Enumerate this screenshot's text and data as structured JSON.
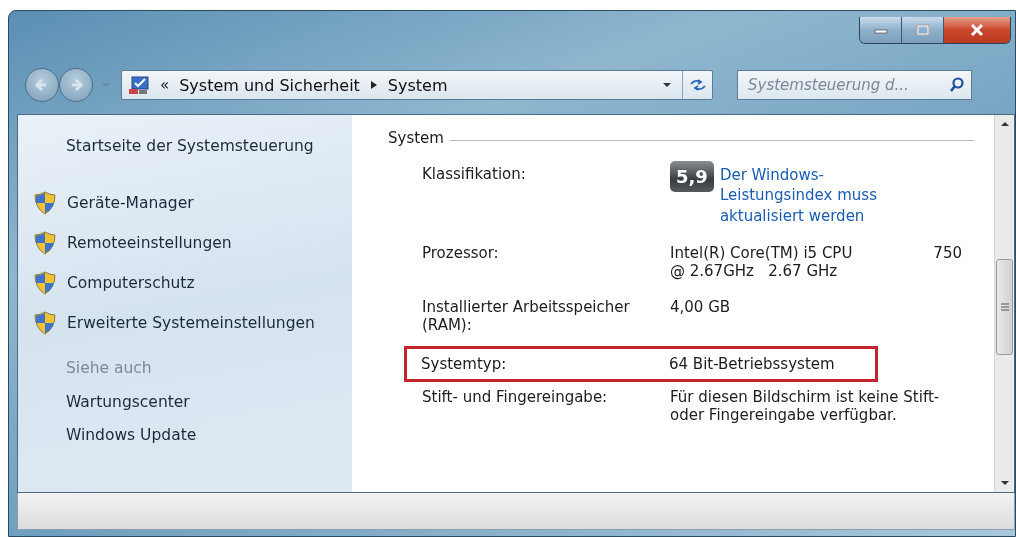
{
  "address_bar": {
    "overflow": "«",
    "breadcrumb": [
      {
        "label": "System und Sicherheit"
      },
      {
        "label": "System"
      }
    ]
  },
  "search": {
    "placeholder": "Systemsteuerung d..."
  },
  "sidebar": {
    "home_link": "Startseite der Systemsteuerung",
    "tasks": [
      {
        "label": "Geräte-Manager"
      },
      {
        "label": "Remoteeinstellungen"
      },
      {
        "label": "Computerschutz"
      },
      {
        "label": "Erweiterte Systemeinstellungen"
      }
    ],
    "see_also_heading": "Siehe auch",
    "see_also": [
      {
        "label": "Wartungscenter"
      },
      {
        "label": "Windows Update"
      }
    ]
  },
  "section": {
    "title": "System",
    "rows": [
      {
        "label": "Klassifikation:",
        "kind": "rating",
        "badge": "5,9",
        "value": "Der Windows-Leistungsindex muss aktualisiert werden",
        "highlighted": false
      },
      {
        "label": "Prozessor:",
        "kind": "processor",
        "value": "Intel(R) Core(TM) i5 CPU",
        "value_2": "750",
        "value_3": "@ 2.67GHz   2.67 GHz",
        "highlighted": false
      },
      {
        "label": "Installierter Arbeitsspeicher (RAM):",
        "kind": "text",
        "value": "4,00 GB",
        "highlighted": false
      },
      {
        "label": "Systemtyp:",
        "kind": "text",
        "value": "64 Bit-Betriebssystem",
        "highlighted": true
      },
      {
        "label": "Stift- und Fingereingabe:",
        "kind": "text",
        "value": "Für diesen Bildschirm ist keine Stift- oder Fingereingabe verfügbar.",
        "highlighted": false
      }
    ]
  }
}
